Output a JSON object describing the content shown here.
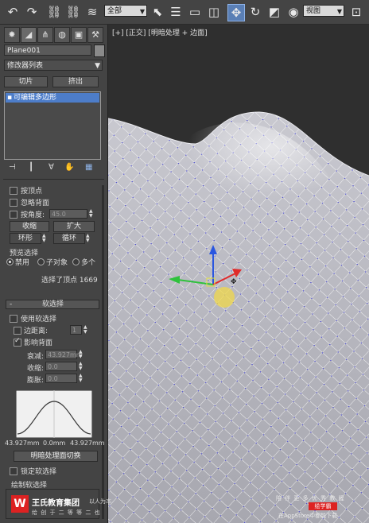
{
  "toolbar": {
    "undo_icon": "undo-icon",
    "redo_icon": "redo-icon",
    "selection_filter": "全部",
    "view_combo": "视图"
  },
  "panel": {
    "object_name": "Plane001",
    "modifier_list": "修改器列表",
    "btn_slice": "切片",
    "btn_extrude": "挤出",
    "stack_item": "可编辑多边形",
    "selection": {
      "by_vertex": "按顶点",
      "ignore_back": "忽略背面",
      "by_angle": "按角度:",
      "angle_value": "45.0",
      "shrink": "收缩",
      "grow": "扩大",
      "ring": "环形",
      "loop": "循环",
      "preview_title": "预览选择",
      "preview_options": [
        "禁用",
        "子对象",
        "多个"
      ],
      "status": "选择了顶点 1669"
    },
    "soft": {
      "title": "软选择",
      "use_soft": "使用软选择",
      "edge_distance": "边距离:",
      "edge_distance_value": "1",
      "affect_back": "影响背面",
      "falloff_label": "衰减:",
      "falloff_value": "43.927mm",
      "pinch_label": "收缩:",
      "pinch_value": "0.0",
      "bubble_label": "膨胀:",
      "bubble_value": "0.0",
      "curve_left": "43.927mm",
      "curve_mid": "0.0mm",
      "curve_right": "43.927mm",
      "shaded_toggle": "明暗处理面切换",
      "lock_soft": "锁定软选择",
      "paint_soft": "绘制软选择"
    }
  },
  "viewport": {
    "label": "[+] [正交] [明暗处理 + 边面]"
  },
  "watermark": {
    "brand": "王氏教育集团",
    "tagline": "以人为本",
    "subline": "给 创 于 二 等 等 二 也",
    "right_top": "陪 伴 更 多 优 秀 教 程",
    "right_badge": "绘学霸",
    "right_bottom": "在AppStore中都能下载"
  }
}
